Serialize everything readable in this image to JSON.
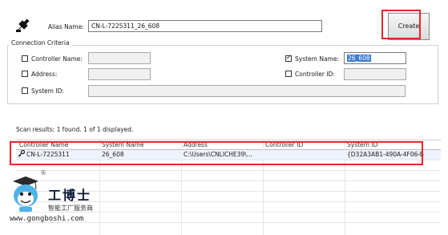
{
  "alias": {
    "label": "Alias Name:",
    "value": "CN-L-7225311_26_608"
  },
  "create_button": "Create",
  "criteria": {
    "title": "Connection Criteria",
    "controller_name": {
      "label": "Controller Name:",
      "checked": false,
      "value": ""
    },
    "address": {
      "label": "Address:",
      "checked": false,
      "value": ""
    },
    "system_id": {
      "label": "System ID:",
      "checked": false,
      "value": ""
    },
    "system_name": {
      "label": "System Name:",
      "checked": true,
      "value": "26_608"
    },
    "controller_id": {
      "label": "Controller ID:",
      "checked": false,
      "value": ""
    }
  },
  "scan_results": "Scan results: 1 found. 1 of 1 displayed.",
  "table": {
    "columns": [
      "Controller Name",
      "System Name",
      "Address",
      "Controller ID",
      "System ID"
    ],
    "rows": [
      {
        "controller_name": "CN-L-7225311",
        "system_name": "26_608",
        "address": "C:\\Users\\CNLICHE39\\...",
        "controller_id": "",
        "system_id": "{D32A3AB1-490A-4F06-B"
      }
    ]
  },
  "watermark": {
    "brand_cn": "工博士",
    "tagline_cn": "智能工厂服务商",
    "url": "www.gongboshi.com",
    "registered": "®"
  },
  "colors": {
    "highlight": "#e8252a",
    "selection": "#3d7bd4"
  }
}
